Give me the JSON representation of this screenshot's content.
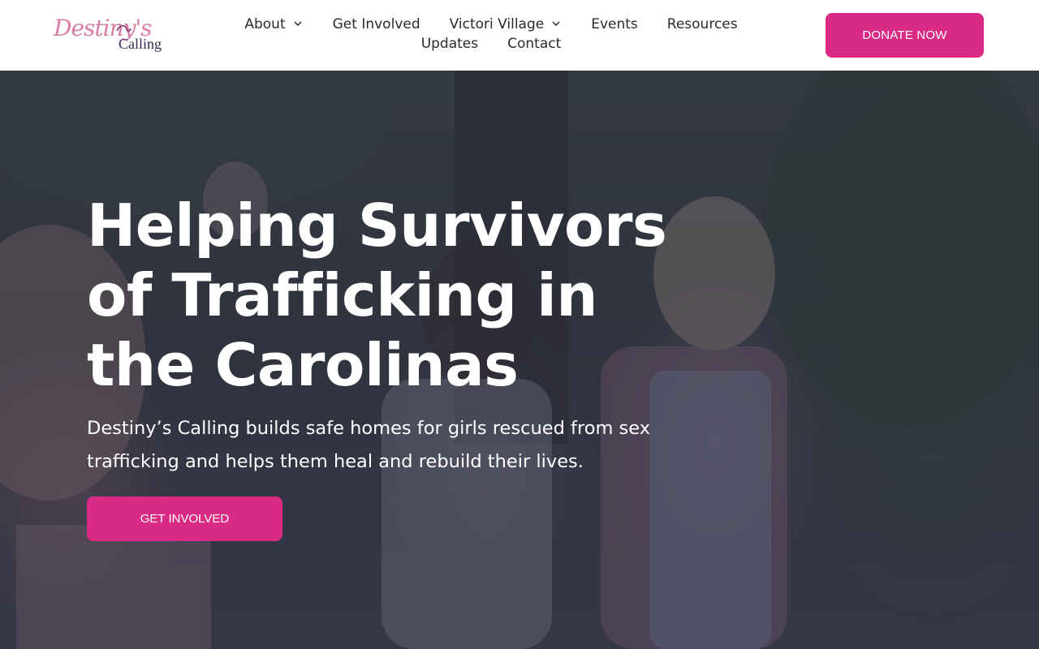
{
  "logo": {
    "script_text": "Destiny's",
    "sub_text": "Calling"
  },
  "nav": {
    "items": [
      {
        "label": "About",
        "has_dropdown": true
      },
      {
        "label": "Get Involved",
        "has_dropdown": false
      },
      {
        "label": "Victori Village",
        "has_dropdown": true
      },
      {
        "label": "Events",
        "has_dropdown": false
      },
      {
        "label": "Resources",
        "has_dropdown": false
      },
      {
        "label": "Updates",
        "has_dropdown": false
      },
      {
        "label": "Contact",
        "has_dropdown": false
      }
    ]
  },
  "header": {
    "donate_label": "DONATE NOW"
  },
  "hero": {
    "title": "Helping Survivors of Trafficking in the Carolinas",
    "subtitle": "Destiny’s Calling builds safe homes for girls rescued from sex trafficking and helps them heal and rebuild their lives.",
    "cta_label": "GET INVOLVED"
  },
  "colors": {
    "brand_pink": "#d92b85",
    "logo_pink": "#d87ba6",
    "logo_purple": "#3a2a55"
  }
}
